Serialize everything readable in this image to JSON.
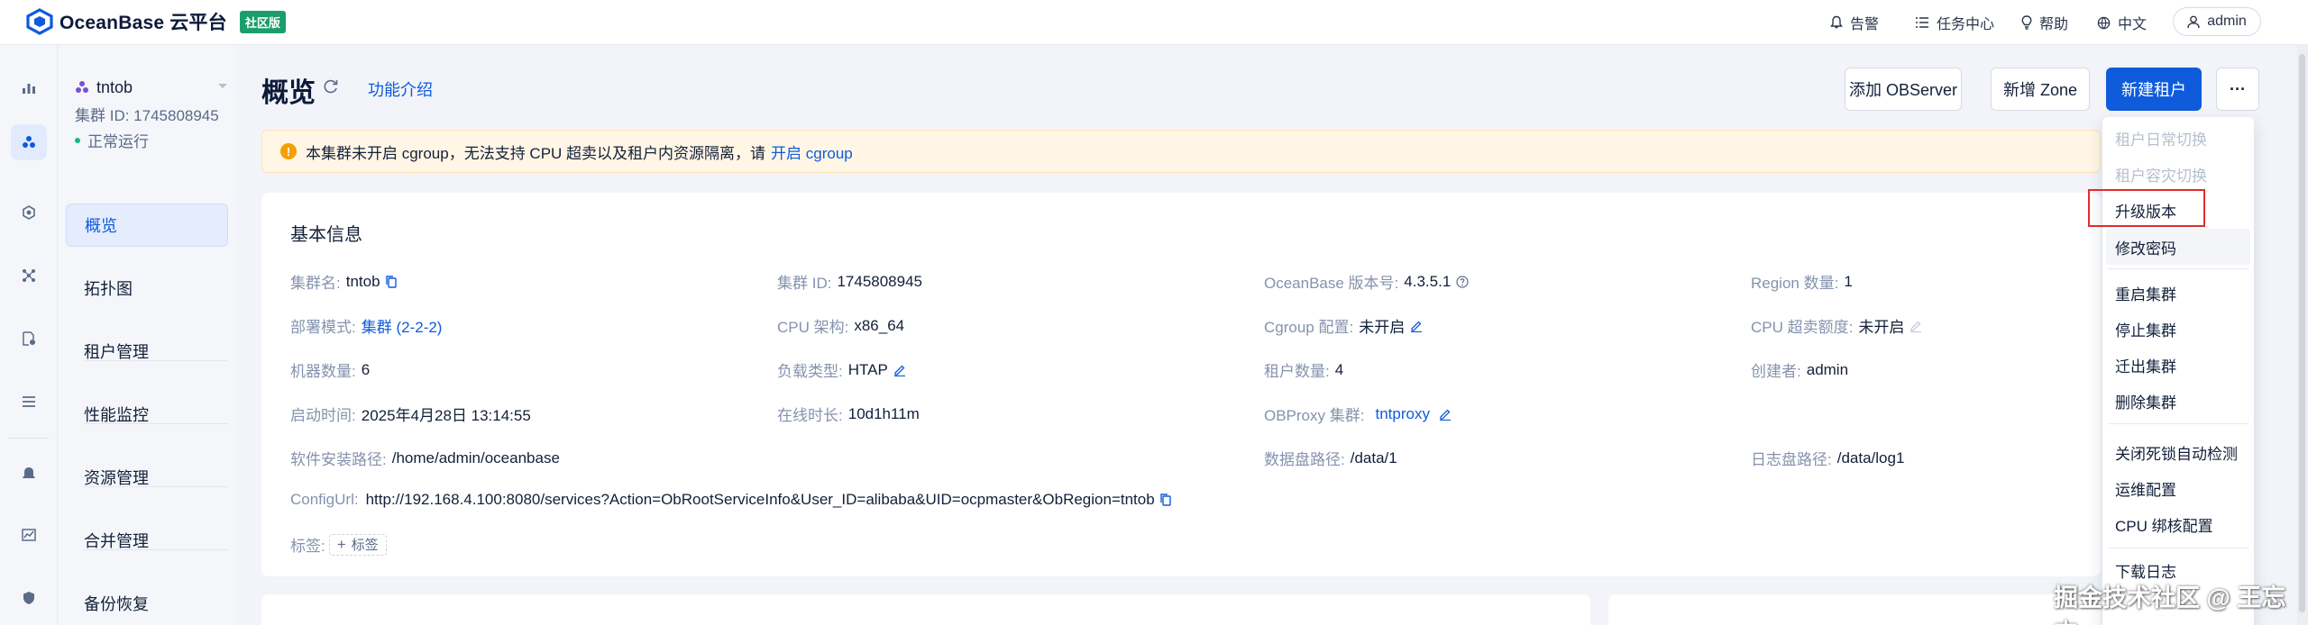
{
  "header": {
    "brand": "OceanBase 云平台",
    "edition_badge": "社区版",
    "alerts": "告警",
    "tasks": "任务中心",
    "help": "帮助",
    "language": "中文",
    "user": "admin"
  },
  "cluster": {
    "name": "tntob",
    "id_line": "集群 ID: 1745808945",
    "status": "正常运行"
  },
  "nav": {
    "items": [
      "概览",
      "拓扑图",
      "租户管理",
      "性能监控",
      "资源管理",
      "合并管理",
      "备份恢复"
    ]
  },
  "page": {
    "title": "概览",
    "feature_link": "功能介绍",
    "buttons": {
      "add_observer": "添加 OBServer",
      "add_zone": "新增 Zone",
      "new_tenant": "新建租户",
      "more": "···"
    }
  },
  "warning": {
    "text": "本集群未开启 cgroup，无法支持 CPU 超卖以及租户内资源隔离，请",
    "link": "开启 cgroup"
  },
  "basic_info": {
    "title": "基本信息",
    "cluster_name_label": "集群名:",
    "cluster_name": "tntob",
    "cluster_id_label": "集群 ID:",
    "cluster_id": "1745808945",
    "version_label": "OceanBase 版本号:",
    "version": "4.3.5.1",
    "region_label": "Region 数量:",
    "region": "1",
    "deploy_label": "部署模式:",
    "deploy": "集群 (2-2-2)",
    "cpu_arch_label": "CPU 架构:",
    "cpu_arch": "x86_64",
    "cgroup_label": "Cgroup 配置:",
    "cgroup": "未开启",
    "cpu_oversell_label": "CPU 超卖额度:",
    "cpu_oversell": "未开启",
    "machines_label": "机器数量:",
    "machines": "6",
    "load_type_label": "负载类型:",
    "load_type": "HTAP",
    "tenants_label": "租户数量:",
    "tenants": "4",
    "creator_label": "创建者:",
    "creator": "admin",
    "start_time_label": "启动时间:",
    "start_time": "2025年4月28日 13:14:55",
    "uptime_label": "在线时长:",
    "uptime": "10d1h11m",
    "obproxy_label": "OBProxy 集群:",
    "obproxy": "tntproxy",
    "install_path_label": "软件安装路径:",
    "install_path": "/home/admin/oceanbase",
    "data_path_label": "数据盘路径:",
    "data_path": "/data/1",
    "log_path_label": "日志盘路径:",
    "log_path": "/data/log1",
    "config_url_label": "ConfigUrl:",
    "config_url": "http://192.168.4.100:8080/services?Action=ObRootServiceInfo&User_ID=alibaba&UID=ocpmaster&ObRegion=tntob",
    "tags_label": "标签:",
    "add_tag": "标签"
  },
  "more_menu": {
    "items": [
      "租户日常切换",
      "租户容灾切换",
      "升级版本",
      "修改密码",
      "重启集群",
      "停止集群",
      "迁出集群",
      "删除集群",
      "关闭死锁自动检测",
      "运维配置",
      "CPU 绑核配置",
      "下载日志"
    ],
    "disabled": [
      0,
      1
    ],
    "highlighted": 2
  },
  "watermark": "掘金技术社区 @ 王忘杰",
  "colors": {
    "primary": "#0e5bdb",
    "warning_bg": "#fff6e5",
    "warning_icon": "#f59f00",
    "status_green": "#18b87a",
    "badge_green": "#1a9e6b",
    "highlight_red": "#e12b2b"
  }
}
